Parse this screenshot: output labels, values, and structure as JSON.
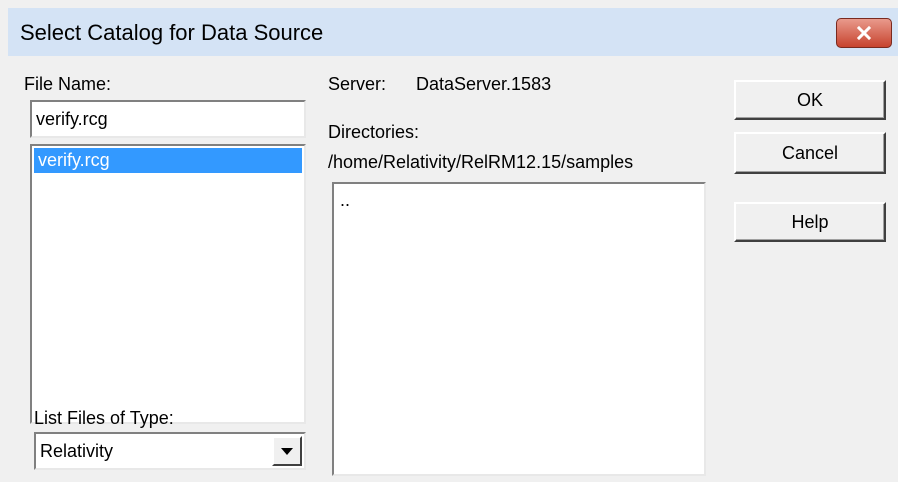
{
  "window": {
    "title": "Select Catalog for Data Source",
    "close_icon": "close-icon"
  },
  "file_name": {
    "label": "File Name:",
    "value": "verify.rcg",
    "list_items": [
      "verify.rcg"
    ],
    "selected_index": 0
  },
  "file_type": {
    "label": "List Files of Type:",
    "selected": "Relativity"
  },
  "server": {
    "label": "Server:",
    "value": "DataServer.1583"
  },
  "directories": {
    "label": "Directories:",
    "path": "/home/Relativity/RelRM12.15/samples",
    "items": [
      ".."
    ]
  },
  "buttons": {
    "ok": "OK",
    "cancel": "Cancel",
    "help": "Help"
  },
  "colors": {
    "titlebar": "#d4e3f5",
    "selection": "#3399ff",
    "close_button": "#c7432e"
  }
}
